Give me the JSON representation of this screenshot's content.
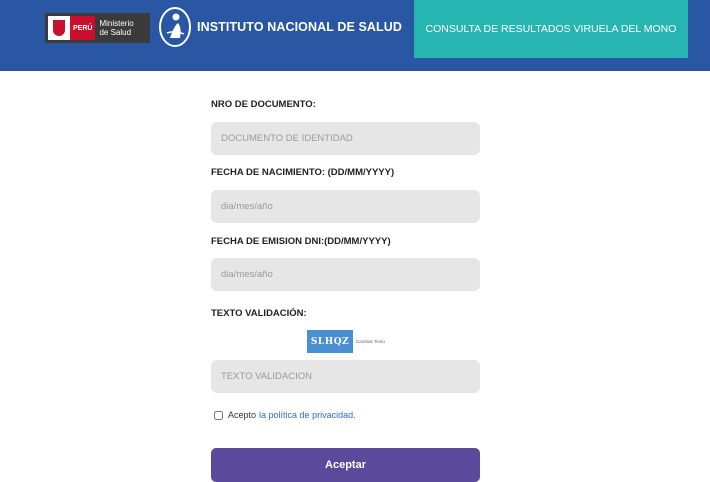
{
  "header": {
    "minsa_logo": {
      "country": "PERÚ",
      "ministry_line1": "Ministerio",
      "ministry_line2": "de Salud"
    },
    "title": "INSTITUTO NACIONAL DE SALUD",
    "consulta_label": "CONSULTA DE RESULTADOS VIRUELA DEL MONO"
  },
  "form": {
    "document": {
      "label": "NRO DE DOCUMENTO:",
      "placeholder": "DOCUMENTO DE IDENTIDAD",
      "value": ""
    },
    "birth_date": {
      "label": "FECHA DE NACIMIENTO: (DD/MM/YYYY)",
      "placeholder": "dia/mes/año",
      "value": ""
    },
    "dni_date": {
      "label": "FECHA DE EMISION DNI:(DD/MM/YYYY)",
      "placeholder": "dia/mes/año",
      "value": ""
    },
    "validation": {
      "label": "TEXTO VALIDACIÓN:",
      "captcha_text": "SLHQZ",
      "change_text": "Cambiar Texto",
      "placeholder": "TEXTO VALIDACION",
      "value": ""
    },
    "privacy": {
      "prefix": "Acepto",
      "link": "la política de privacidad.",
      "checked": false
    },
    "submit_label": "Aceptar"
  },
  "colors": {
    "header_bg": "#2a57a3",
    "consulta_bg": "#26b5b0",
    "submit_bg": "#5a4a9c",
    "field_bg": "#e6e6e6",
    "link": "#2a6ec8"
  },
  "icons": [
    "peru-coat-of-arms-icon",
    "ins-emblem-icon",
    "checkbox-icon"
  ]
}
